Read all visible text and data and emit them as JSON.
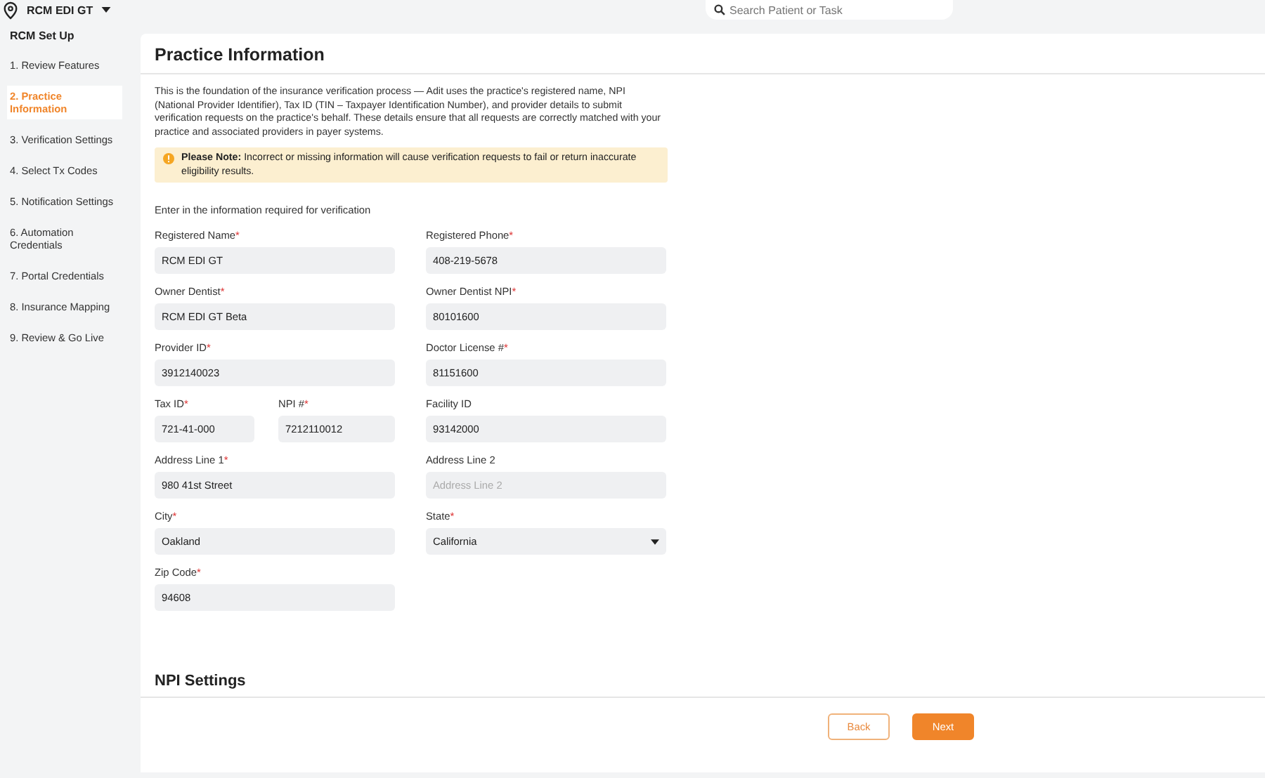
{
  "topbar": {
    "location": "RCM EDI GT",
    "search": {
      "placeholder": "Search Patient or Task"
    }
  },
  "sidebar": {
    "title": "RCM Set Up",
    "items": [
      {
        "label": "1. Review Features",
        "selected": false
      },
      {
        "label": "2. Practice Information",
        "selected": true
      },
      {
        "label": "3. Verification Settings",
        "selected": false
      },
      {
        "label": "4. Select Tx Codes",
        "selected": false
      },
      {
        "label": "5. Notification Settings",
        "selected": false
      },
      {
        "label": "6. Automation Credentials",
        "selected": false
      },
      {
        "label": "7. Portal Credentials",
        "selected": false
      },
      {
        "label": "8. Insurance Mapping",
        "selected": false
      },
      {
        "label": "9. Review & Go Live",
        "selected": false
      }
    ]
  },
  "page": {
    "title": "Practice Information",
    "intro": "This is the foundation of the insurance verification process — Adit uses the practice's registered name, NPI (National Provider Identifier), Tax ID (TIN – Taxpayer Identification Number), and provider details to submit verification requests on the practice's behalf. These details ensure that all requests are correctly matched with your practice and associated providers in payer systems.",
    "note": "**Please Note:** Incorrect or missing information will cause verification requests to fail or return inaccurate eligibility results.",
    "instructions": "Enter in the information required for verification",
    "rows": [
      {
        "left": [
          {
            "kind": "text",
            "label": "Registered Name",
            "required_mark": "*",
            "value": "RCM EDI GT"
          }
        ],
        "right": [
          {
            "kind": "text",
            "label": "Registered Phone",
            "required_mark": "*",
            "value": "408-219-5678"
          }
        ]
      },
      {
        "left": [
          {
            "kind": "text",
            "label": "Owner Dentist",
            "required_mark": "*",
            "value": "RCM EDI GT Beta"
          }
        ],
        "right": [
          {
            "kind": "text",
            "label": "Owner Dentist NPI",
            "required_mark": "*",
            "value": "80101600"
          }
        ]
      },
      {
        "left": [
          {
            "kind": "text",
            "label": "Provider ID",
            "required_mark": "*",
            "value": "3912140023"
          }
        ],
        "right": [
          {
            "kind": "text",
            "label": "Doctor License #",
            "required_mark": "*",
            "value": "81151600"
          }
        ]
      },
      {
        "left": [
          {
            "kind": "text",
            "label": "Tax ID",
            "required_mark": "*",
            "value": "721-41-000"
          },
          {
            "kind": "text",
            "label": "NPI #",
            "required_mark": "*",
            "value": "7212110012"
          }
        ],
        "right": [
          {
            "kind": "text",
            "label": "Facility ID",
            "value": "93142000"
          }
        ]
      },
      {
        "left": [
          {
            "kind": "text",
            "label": "Address Line 1",
            "required_mark": "*",
            "value": "980 41st Street"
          }
        ],
        "right": [
          {
            "kind": "text",
            "label": "Address Line 2",
            "placeholder": "Address Line 2"
          }
        ]
      },
      {
        "left": [
          {
            "kind": "text",
            "label": "City",
            "required_mark": "*",
            "value": "Oakland"
          }
        ],
        "right": [
          {
            "kind": "select",
            "label": "State",
            "required_mark": "*",
            "value": "California"
          }
        ]
      },
      {
        "left": [
          {
            "kind": "text",
            "label": "Zip Code",
            "required_mark": "*",
            "value": "94608"
          }
        ],
        "right": []
      }
    ],
    "next_section": "NPI Settings",
    "buttons": [
      {
        "label": "Back",
        "kind": "secondary"
      },
      {
        "label": "Next",
        "kind": "primary"
      }
    ]
  }
}
